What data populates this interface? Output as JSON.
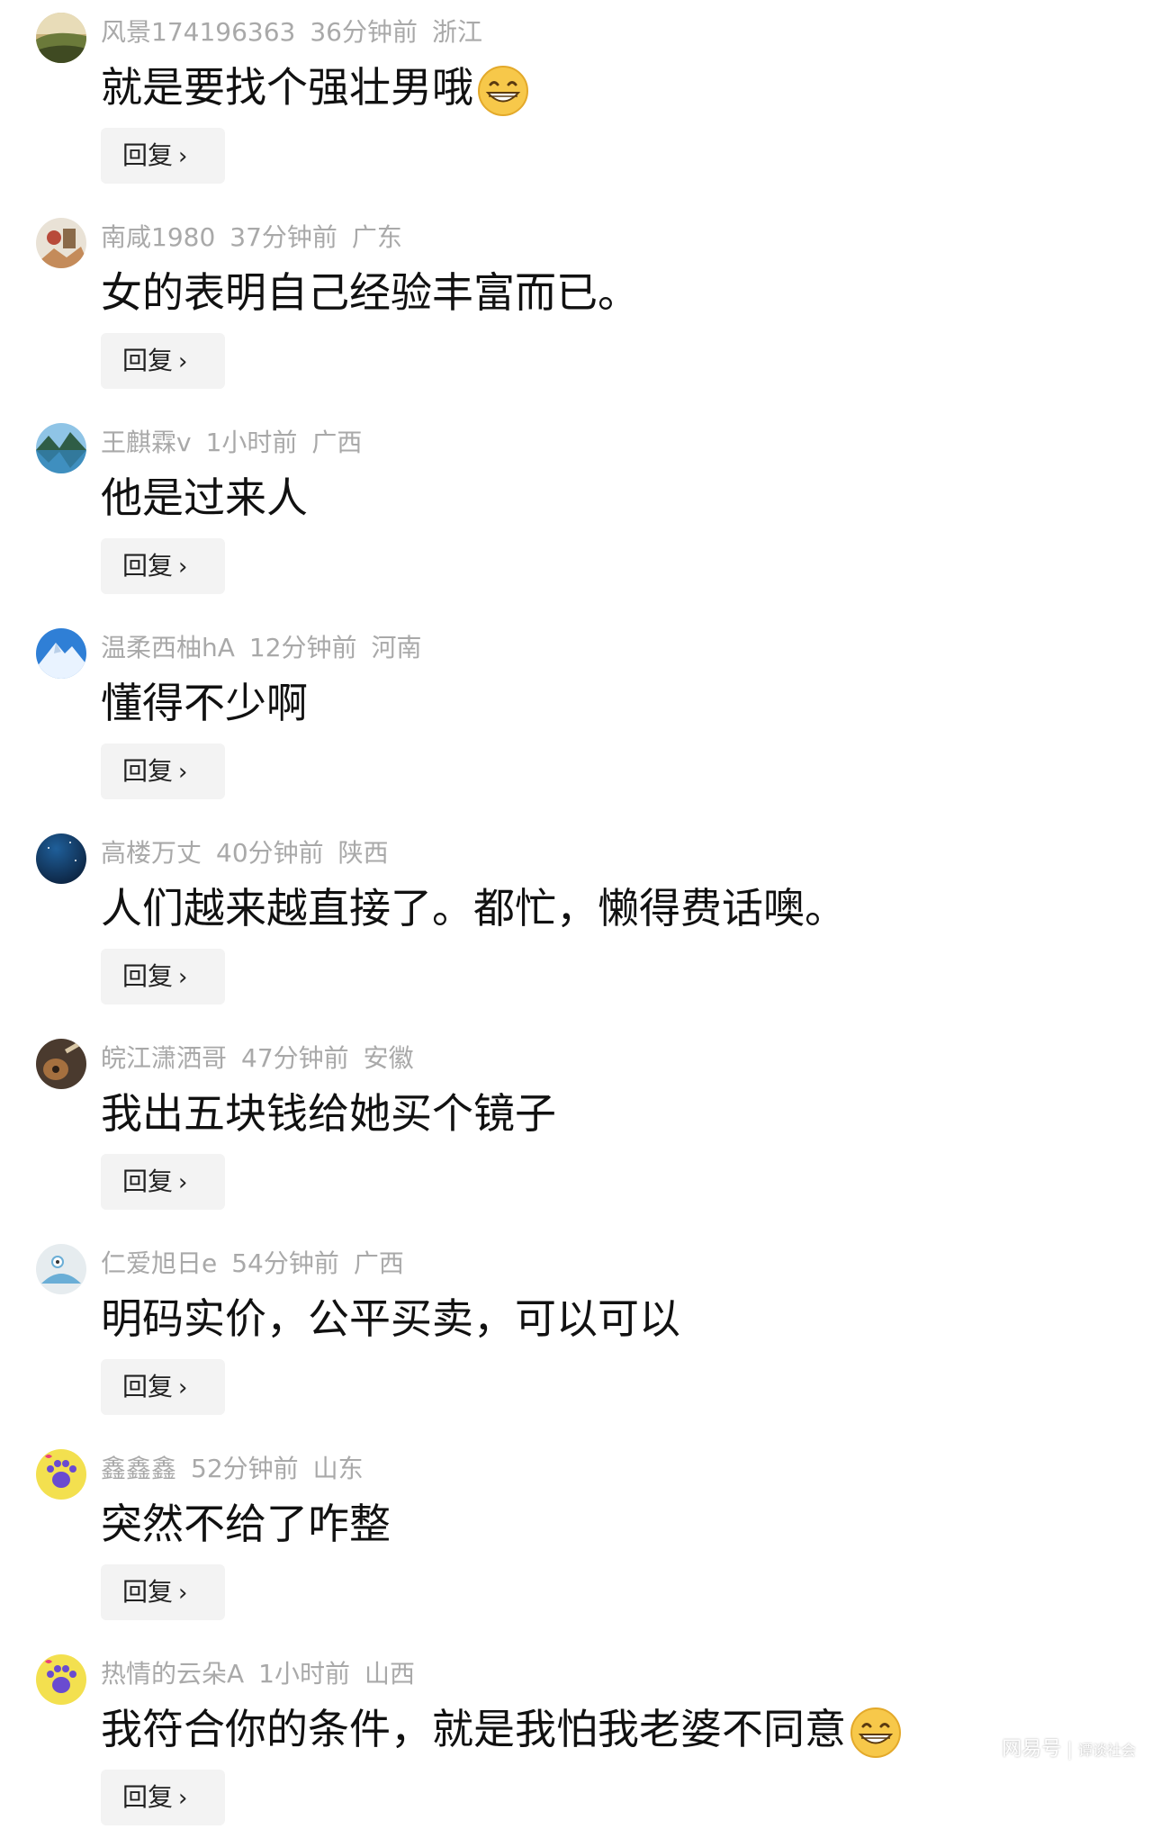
{
  "comments": [
    {
      "user": "风景174196363",
      "time": "36分钟前",
      "location": "浙江",
      "text": "就是要找个强壮男哦",
      "emoji": true,
      "avatar": "landscape-hill",
      "reply_label": "回复"
    },
    {
      "user": "南咸1980",
      "time": "37分钟前",
      "location": "广东",
      "text": "女的表明自己经验丰富而已。",
      "emoji": false,
      "avatar": "painting",
      "reply_label": "回复"
    },
    {
      "user": "王麒霖v",
      "time": "1小时前",
      "location": "广西",
      "text": "他是过来人",
      "emoji": false,
      "avatar": "lake-mountain",
      "reply_label": "回复"
    },
    {
      "user": "温柔西柚hA",
      "time": "12分钟前",
      "location": "河南",
      "text": "懂得不少啊",
      "emoji": false,
      "avatar": "snow-mountain",
      "reply_label": "回复"
    },
    {
      "user": "高楼万丈",
      "time": "40分钟前",
      "location": "陕西",
      "text": "人们越来越直接了。都忙，懒得费话噢。",
      "emoji": false,
      "avatar": "night-sky",
      "reply_label": "回复"
    },
    {
      "user": "皖江潇洒哥",
      "time": "47分钟前",
      "location": "安徽",
      "text": "我出五块钱给她买个镜子",
      "emoji": false,
      "avatar": "guitar",
      "reply_label": "回复"
    },
    {
      "user": "仁爱旭日e",
      "time": "54分钟前",
      "location": "广西",
      "text": "明码实价，公平买卖，可以可以",
      "emoji": false,
      "avatar": "cartoon-bird",
      "reply_label": "回复"
    },
    {
      "user": "鑫鑫鑫",
      "time": "52分钟前",
      "location": "山东",
      "text": "突然不给了咋整",
      "emoji": false,
      "avatar": "paw",
      "reply_label": "回复"
    },
    {
      "user": "热情的云朵A",
      "time": "1小时前",
      "location": "山西",
      "text": "我符合你的条件，就是我怕我老婆不同意",
      "emoji": true,
      "avatar": "paw",
      "reply_label": "回复"
    }
  ],
  "watermark": {
    "brand": "网易号",
    "account": "谭谈社会"
  },
  "colors": {
    "meta": "#a9a9a9",
    "text": "#111111",
    "reply_bg": "#f3f3f3"
  }
}
